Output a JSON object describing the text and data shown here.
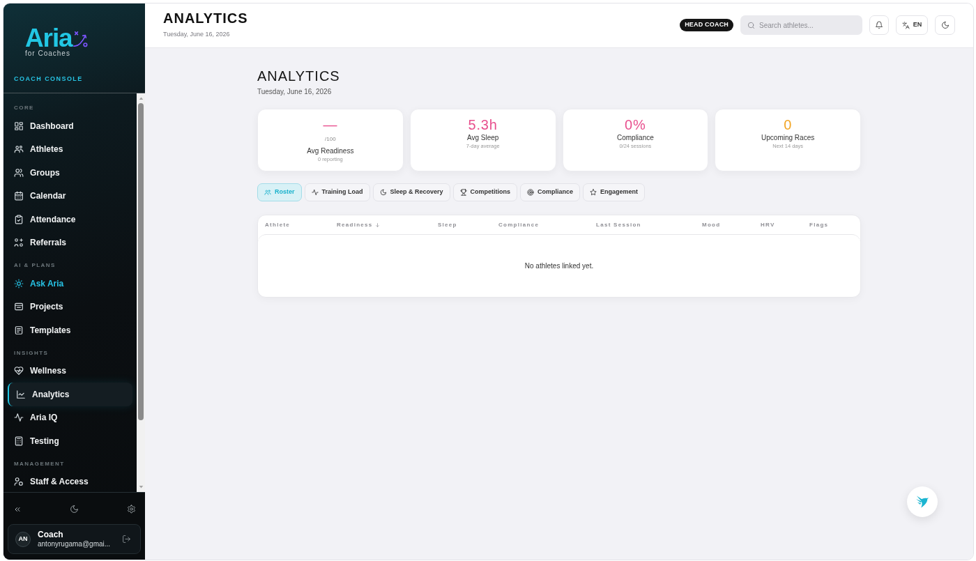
{
  "sidebar": {
    "brand": {
      "name": "Aria",
      "tagline": "for Coaches"
    },
    "console_label": "COACH CONSOLE",
    "sections": [
      {
        "title": "CORE",
        "items": [
          {
            "label": "Dashboard",
            "selected": false,
            "accent": false
          },
          {
            "label": "Athletes",
            "selected": false,
            "accent": false
          },
          {
            "label": "Groups",
            "selected": false,
            "accent": false
          },
          {
            "label": "Calendar",
            "selected": false,
            "accent": false
          },
          {
            "label": "Attendance",
            "selected": false,
            "accent": false
          },
          {
            "label": "Referrals",
            "selected": false,
            "accent": false
          }
        ]
      },
      {
        "title": "AI & PLANS",
        "items": [
          {
            "label": "Ask Aria",
            "selected": false,
            "accent": true
          },
          {
            "label": "Projects",
            "selected": false,
            "accent": false
          },
          {
            "label": "Templates",
            "selected": false,
            "accent": false
          }
        ]
      },
      {
        "title": "INSIGHTS",
        "items": [
          {
            "label": "Wellness",
            "selected": false,
            "accent": false
          },
          {
            "label": "Analytics",
            "selected": true,
            "accent": false
          },
          {
            "label": "Aria IQ",
            "selected": false,
            "accent": false
          },
          {
            "label": "Testing",
            "selected": false,
            "accent": false
          }
        ]
      },
      {
        "title": "MANAGEMENT",
        "items": [
          {
            "label": "Staff & Access",
            "selected": false,
            "accent": false
          }
        ]
      }
    ],
    "user": {
      "initials": "AN",
      "name": "Coach",
      "email": "antonyrugama@gmai..."
    }
  },
  "header": {
    "title": "ANALYTICS",
    "date": "Tuesday, June 16, 2026",
    "role_badge": "HEAD COACH",
    "search": {
      "placeholder": "Search athletes..."
    },
    "language": "EN"
  },
  "main": {
    "title": "ANALYTICS",
    "date": "Tuesday, June 16, 2026",
    "stats": [
      {
        "value": "—",
        "unit": "/100",
        "label": "Avg Readiness",
        "note": "0 reporting",
        "color": "#e8508e"
      },
      {
        "value": "5.3h",
        "label": "Avg Sleep",
        "note": "7-day average",
        "color": "#e8508e"
      },
      {
        "value": "0%",
        "label": "Compliance",
        "note": "0/24 sessions",
        "color": "#e8508e"
      },
      {
        "value": "0",
        "label": "Upcoming Races",
        "note": "Next 14 days",
        "color": "#f2a524"
      }
    ],
    "tabs": [
      {
        "label": "Roster",
        "selected": true
      },
      {
        "label": "Training Load",
        "selected": false
      },
      {
        "label": "Sleep & Recovery",
        "selected": false
      },
      {
        "label": "Competitions",
        "selected": false
      },
      {
        "label": "Compliance",
        "selected": false
      },
      {
        "label": "Engagement",
        "selected": false
      }
    ],
    "table": {
      "columns": [
        {
          "label": "Athlete",
          "sorted": false
        },
        {
          "label": "Readiness",
          "sorted": true
        },
        {
          "label": "Sleep",
          "sorted": false
        },
        {
          "label": "Compliance",
          "sorted": false
        },
        {
          "label": "Last Session",
          "sorted": false
        },
        {
          "label": "Mood",
          "sorted": false
        },
        {
          "label": "HRV",
          "sorted": false
        },
        {
          "label": "Flags",
          "sorted": false
        }
      ],
      "empty_message": "No athletes linked yet."
    }
  }
}
